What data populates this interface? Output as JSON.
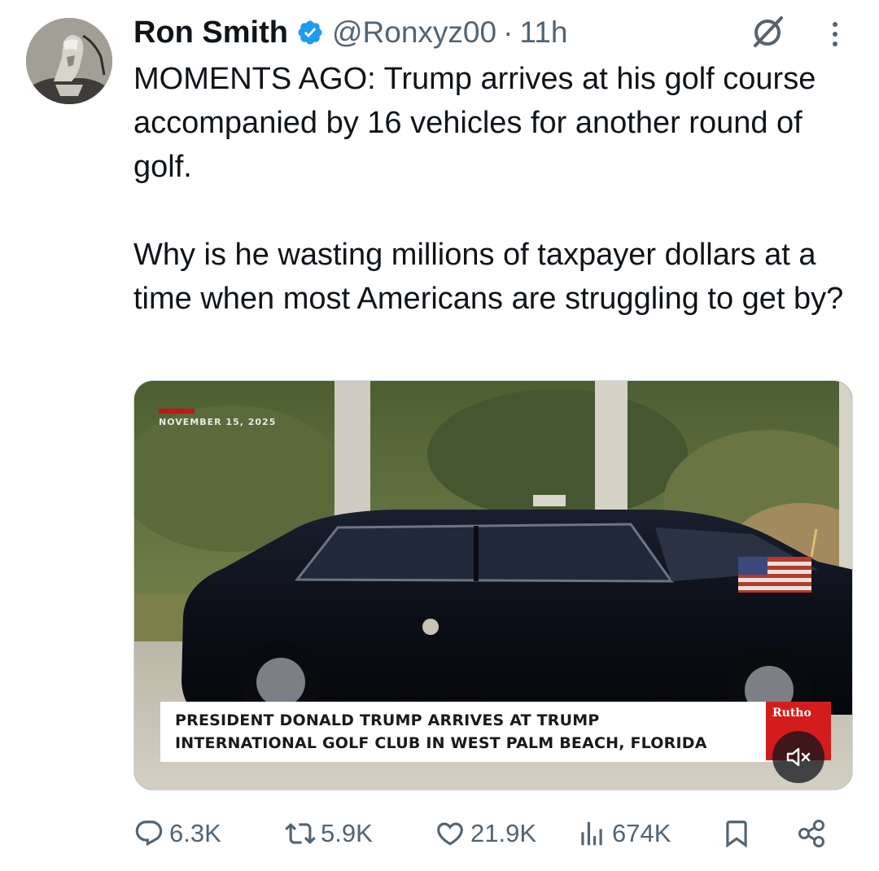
{
  "tweet": {
    "author_name": "Ron Smith",
    "handle": "@Ronxyz00",
    "separator": "·",
    "time": "11h",
    "text_paragraphs": [
      "MOMENTS AGO: Trump arrives at his golf course accompanied by 16 vehicles for another round of golf.",
      "Why is he wasting millions of taxpayer dollars at a time when most Americans are struggling to get by?"
    ]
  },
  "media": {
    "date_stamp": "NOVEMBER 15, 2025",
    "caption_line1": "PRESIDENT DONALD TRUMP ARRIVES AT TRUMP",
    "caption_line2": "INTERNATIONAL GOLF CLUB IN WEST PALM BEACH, FLORIDA",
    "brand_text": "Rutho",
    "mute_icon": "speaker-muted-icon"
  },
  "actions": {
    "replies": "6.3K",
    "reposts": "5.9K",
    "likes": "21.9K",
    "views": "674K"
  },
  "colors": {
    "text_primary": "#0f1419",
    "text_secondary": "#536471",
    "verified_blue": "#1d9bf0",
    "banner_red": "#d41c1c"
  },
  "icons": {
    "verified": "verified-badge-icon",
    "grok": "grok-icon",
    "more": "more-vertical-icon",
    "reply": "reply-icon",
    "repost": "repost-icon",
    "like": "heart-icon",
    "views": "views-bar-icon",
    "bookmark": "bookmark-icon",
    "share": "share-icon"
  }
}
